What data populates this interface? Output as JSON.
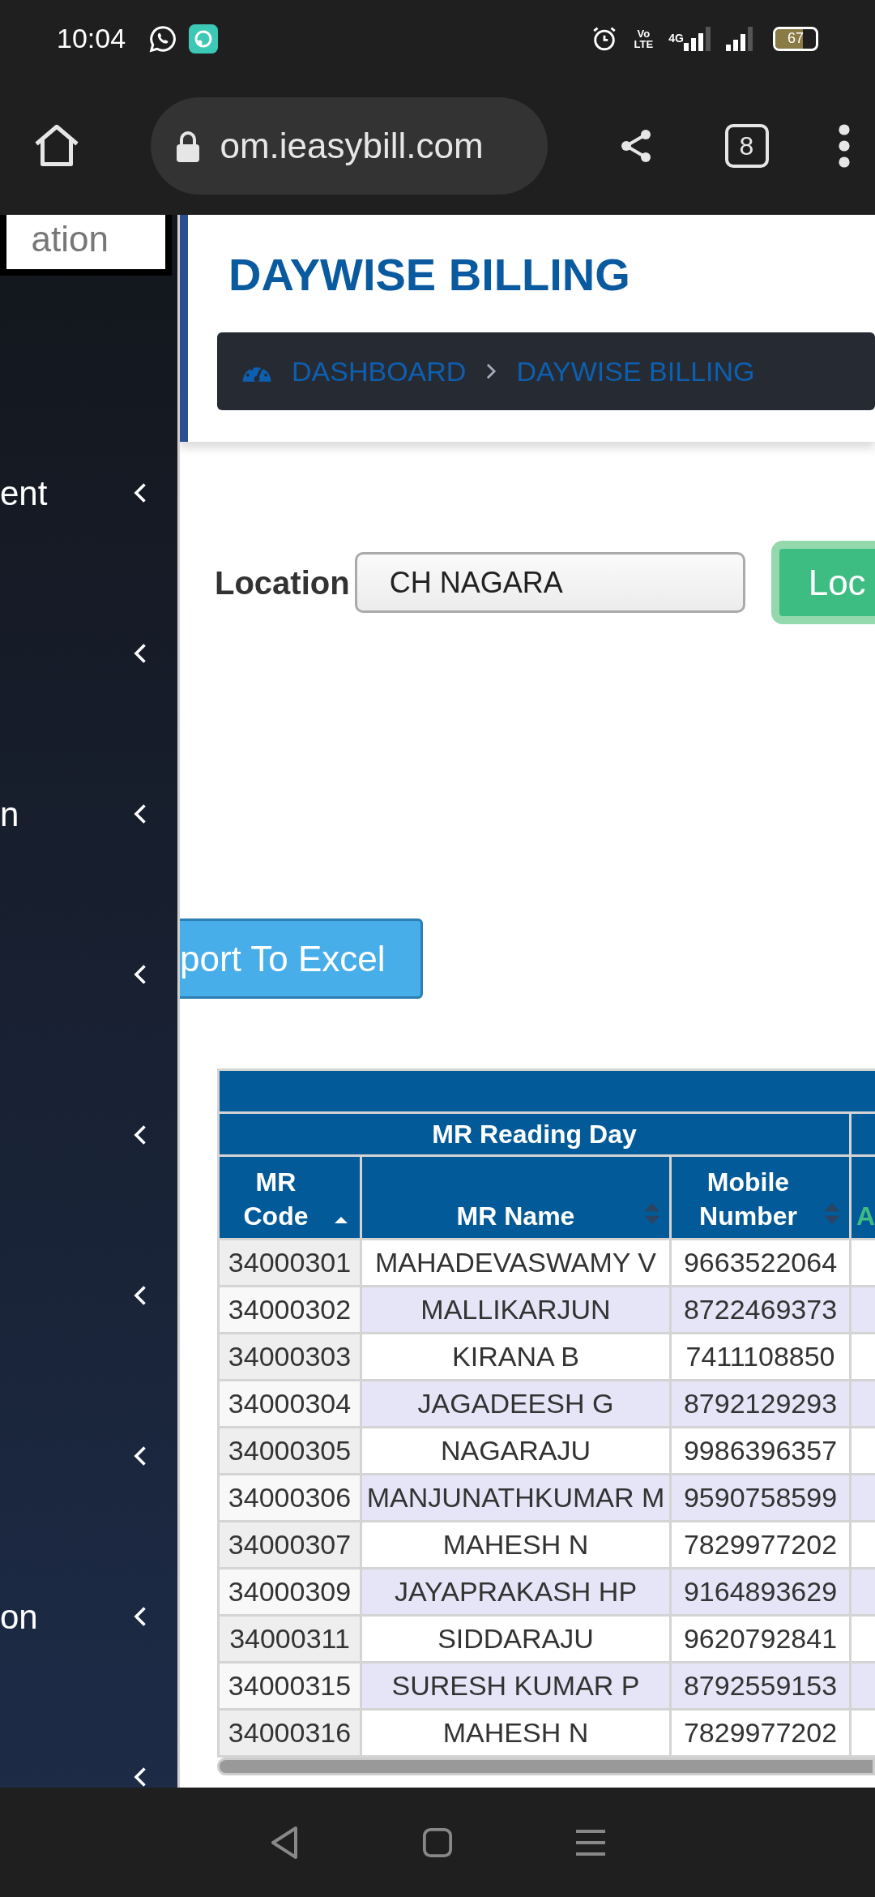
{
  "status_bar": {
    "time": "10:04",
    "network_label": "Vo LTE",
    "data_label": "4G",
    "battery": "67"
  },
  "browser": {
    "url": "om.ieasybill.com",
    "tab_count": "8"
  },
  "sidebar": {
    "search_text": "ation",
    "items": [
      {
        "label": "ent",
        "expanded": false
      },
      {
        "expanded": false
      },
      {
        "label": "n",
        "expanded": false
      },
      {
        "expanded": false
      },
      {
        "expanded": false
      },
      {
        "expanded": false
      },
      {
        "expanded": false
      },
      {
        "label": "on",
        "expanded": false
      },
      {
        "expanded": false
      }
    ]
  },
  "page": {
    "title": "DAYWISE BILLING",
    "breadcrumb": [
      {
        "label": "DASHBOARD",
        "kind": "home"
      },
      {
        "label": "DAYWISE BILLING",
        "kind": "current"
      }
    ]
  },
  "filter": {
    "label": "Location",
    "value": "CH NAGARA",
    "button": "Loc"
  },
  "export_button": "port To Excel",
  "table": {
    "group_header": "MR Reading Day",
    "columns": [
      {
        "label": "MR Code",
        "sortable": true,
        "sort_active": true
      },
      {
        "label": "MR Name",
        "sortable": true,
        "sort_active": false
      },
      {
        "label": "Mobile Number",
        "sortable": true,
        "sort_active": false
      },
      {
        "label": "A"
      }
    ],
    "rows": [
      [
        "34000301",
        "MAHADEVASWAMY V",
        "9663522064"
      ],
      [
        "34000302",
        "MALLIKARJUN",
        "8722469373"
      ],
      [
        "34000303",
        "KIRANA B",
        "7411108850"
      ],
      [
        "34000304",
        "JAGADEESH G",
        "8792129293"
      ],
      [
        "34000305",
        "NAGARAJU",
        "9986396357"
      ],
      [
        "34000306",
        "MANJUNATHKUMAR M",
        "9590758599"
      ],
      [
        "34000307",
        "MAHESH N",
        "7829977202"
      ],
      [
        "34000309",
        "JAYAPRAKASH HP",
        "9164893629"
      ],
      [
        "34000311",
        "SIDDARAJU",
        "9620792841"
      ],
      [
        "34000315",
        "SURESH KUMAR P",
        "8792559153"
      ],
      [
        "34000316",
        "MAHESH N",
        "7829977202"
      ]
    ]
  }
}
